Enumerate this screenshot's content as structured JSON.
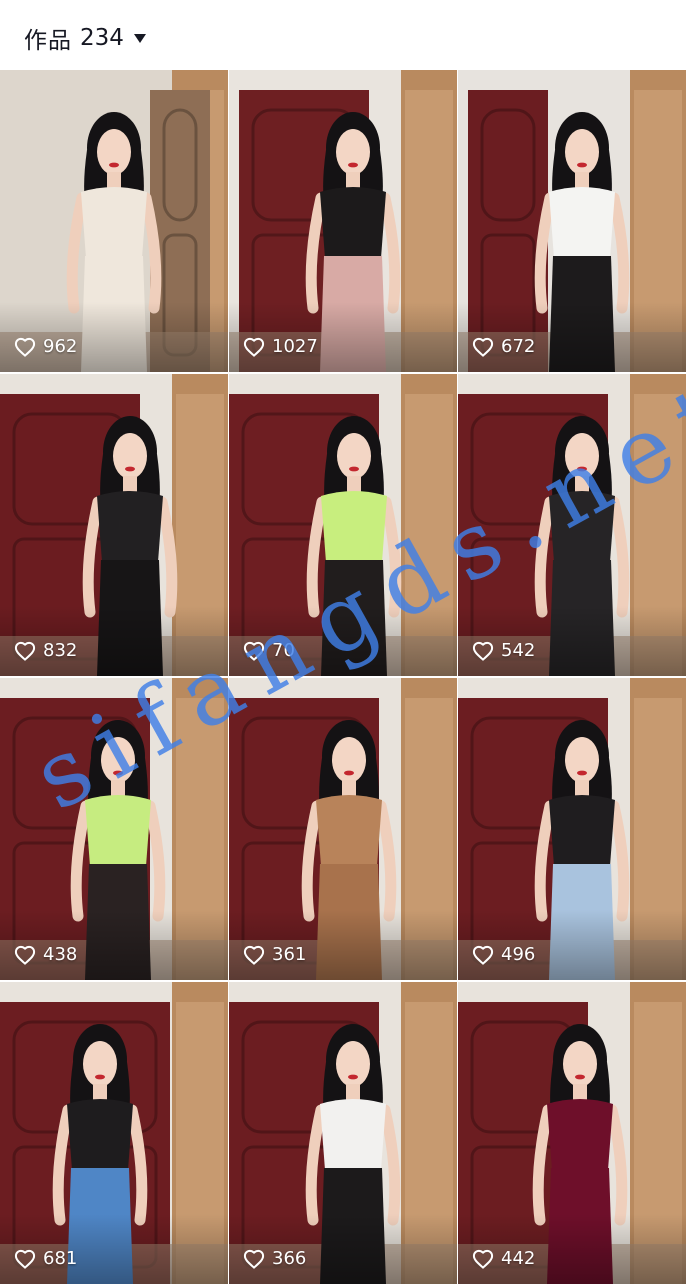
{
  "header": {
    "works_label": "作品",
    "works_count": "234",
    "dropdown_icon": "caret-down-icon"
  },
  "grid": {
    "like_icon": "heart-outline-icon",
    "tiles": [
      {
        "likes": "962",
        "outfit": "cream off-shoulder dress",
        "wall": "#ddd6cc",
        "door": "#8e6e55",
        "top": "#efe7dc",
        "bottom": "#efe7dc"
      },
      {
        "likes": "1027",
        "outfit": "black tank top and pink pants",
        "wall": "#e9e4de",
        "door": "#6e1f22",
        "top": "#1c1a1b",
        "bottom": "#d8aaa5"
      },
      {
        "likes": "672",
        "outfit": "white shirt and black leather skirt",
        "wall": "#e7e3de",
        "door": "#6b1d21",
        "top": "#f4f4f2",
        "bottom": "#1d1b1c"
      },
      {
        "likes": "832",
        "outfit": "black lace top and leather shorts",
        "wall": "#e8e3dc",
        "door": "#6b1c20",
        "top": "#222022",
        "bottom": "#171516"
      },
      {
        "likes": "70",
        "outfit": "lime crop top and black skirt",
        "wall": "#e8e3dc",
        "door": "#6e1e22",
        "top": "#c8ee7e",
        "bottom": "#211d1d"
      },
      {
        "likes": "542",
        "outfit": "black satin dress",
        "wall": "#e8e3dc",
        "door": "#6c1d21",
        "top": "#262426",
        "bottom": "#262426"
      },
      {
        "likes": "438",
        "outfit": "lime crop top",
        "wall": "#e8e3dc",
        "door": "#6c1d21",
        "top": "#c6ec80",
        "bottom": "#2a2222"
      },
      {
        "likes": "361",
        "outfit": "tiger print dress",
        "wall": "#e8e3dc",
        "door": "#6c1d21",
        "top": "#b8835a",
        "bottom": "#a8724c"
      },
      {
        "likes": "496",
        "outfit": "black lace top and light jeans",
        "wall": "#e8e3dc",
        "door": "#6c1d21",
        "top": "#1f1d1f",
        "bottom": "#a9c3de"
      },
      {
        "likes": "681",
        "outfit": "black top and blue jeans",
        "wall": "#e8e3dc",
        "door": "#6c1d21",
        "top": "#1e1c1e",
        "bottom": "#4f86c6"
      },
      {
        "likes": "366",
        "outfit": "white top and black skirt",
        "wall": "#e8e3dc",
        "door": "#6c1d21",
        "top": "#f2f1ef",
        "bottom": "#1c1a1b"
      },
      {
        "likes": "442",
        "outfit": "burgundy velvet dress",
        "wall": "#e8e3dc",
        "door": "#6c1d21",
        "top": "#6e0f2a",
        "bottom": "#6e0f2a"
      }
    ]
  },
  "watermark": {
    "text": "sifangds.net",
    "color": "#3f7fe6"
  }
}
